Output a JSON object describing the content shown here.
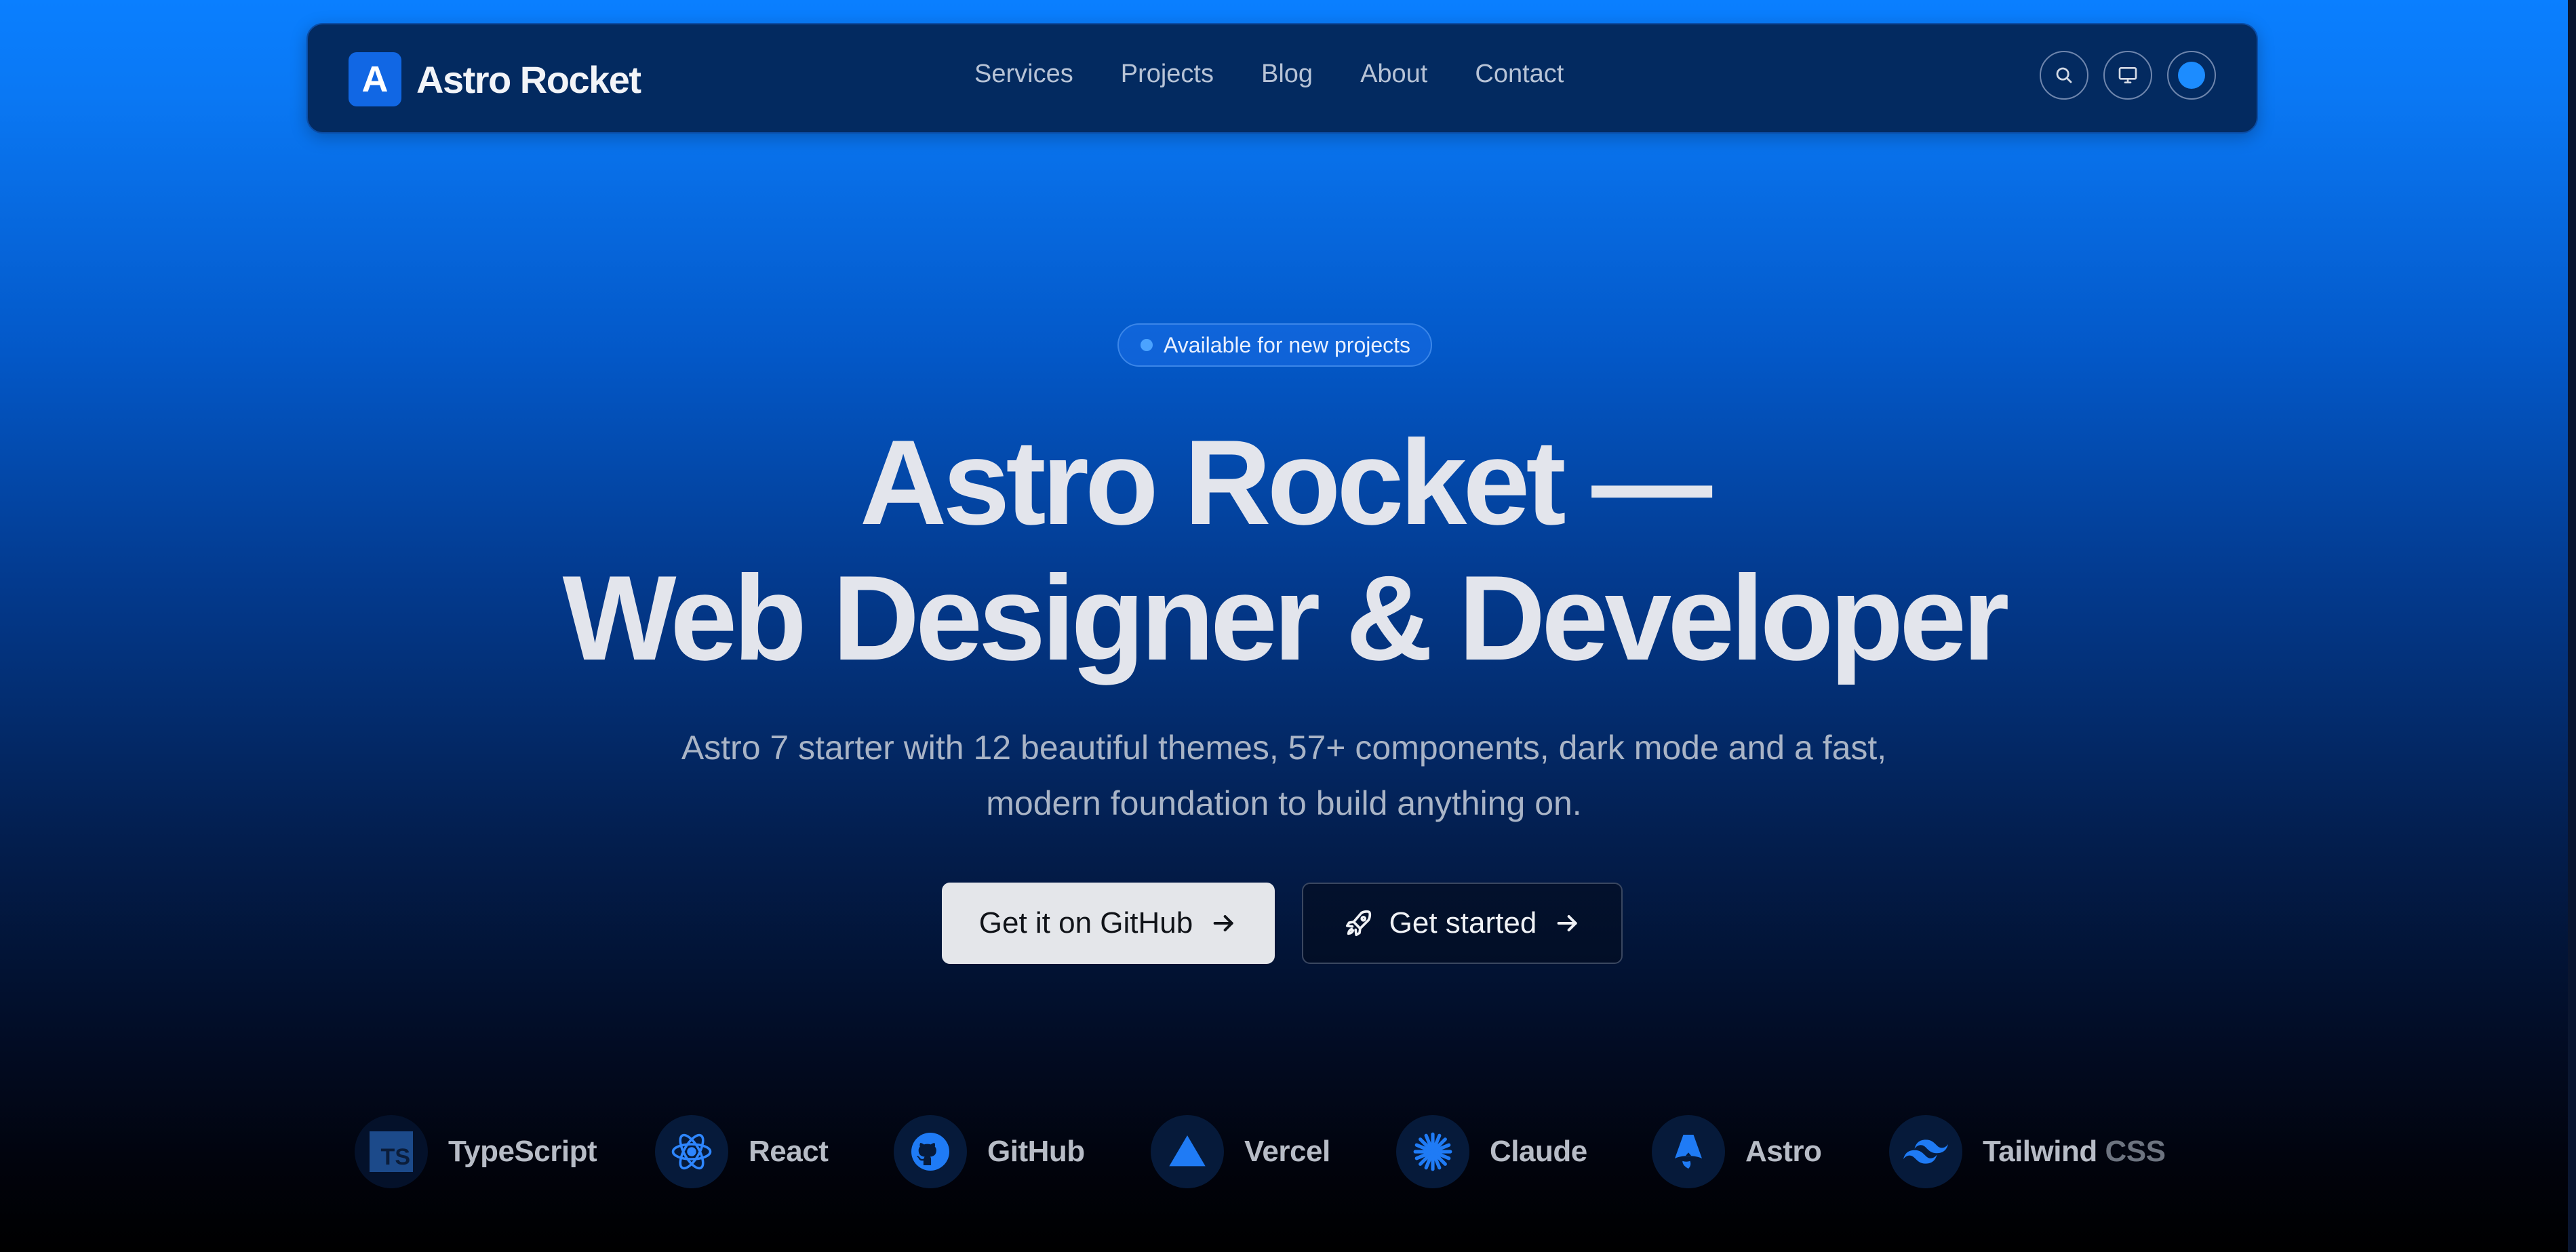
{
  "brand": {
    "logo_letter": "A",
    "name": "Astro Rocket"
  },
  "nav": {
    "links": [
      {
        "label": "Services"
      },
      {
        "label": "Projects"
      },
      {
        "label": "Blog"
      },
      {
        "label": "About"
      },
      {
        "label": "Contact"
      }
    ],
    "actions": [
      {
        "icon": "search-icon"
      },
      {
        "icon": "monitor-icon"
      },
      {
        "icon": "theme-color-icon"
      }
    ]
  },
  "hero": {
    "badge": "Available for new projects",
    "title_line1": "Astro Rocket —",
    "title_line2": "Web Designer & Developer",
    "subtitle_line1": "Astro 7 starter with 12 beautiful themes, 57+ components, dark mode and a fast,",
    "subtitle_line2": "modern foundation to build anything on.",
    "primary_button": "Get it on GitHub",
    "secondary_button": "Get started"
  },
  "tech": [
    {
      "name": "TypeScript",
      "icon": "typescript-icon",
      "icon_text": "TS"
    },
    {
      "name": "React",
      "icon": "react-icon"
    },
    {
      "name": "GitHub",
      "icon": "github-icon"
    },
    {
      "name": "Vercel",
      "icon": "vercel-icon"
    },
    {
      "name": "Claude",
      "icon": "claude-icon"
    },
    {
      "name": "Astro",
      "icon": "astro-icon"
    },
    {
      "name": "Tailwind",
      "name_suffix": "CSS",
      "icon": "tailwind-icon"
    }
  ],
  "colors": {
    "accent": "#0a7fff",
    "brand_logo": "#1167e4",
    "nav_background": "#032a60",
    "title_text": "#e3e5ec",
    "primary_button": "#e4e6ea"
  }
}
